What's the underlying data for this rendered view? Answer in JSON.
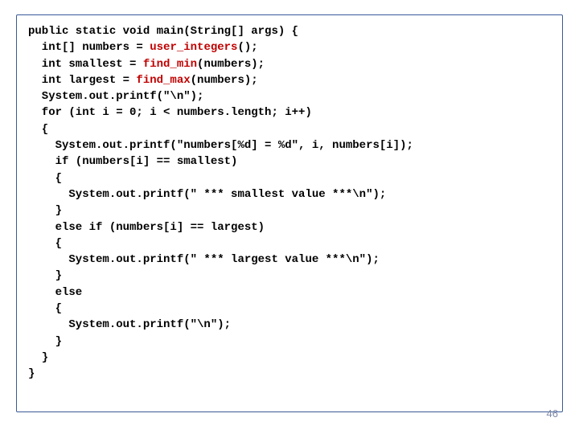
{
  "page_number": "46",
  "code": {
    "l0a": "public static void main(String[] args) {",
    "l1a": "  int[] numbers = ",
    "l1b": "user_integers",
    "l1c": "();",
    "l2a": "  int smallest = ",
    "l2b": "find_min",
    "l2c": "(numbers);",
    "l3a": "  int largest = ",
    "l3b": "find_max",
    "l3c": "(numbers);",
    "l4a": "  System.out.printf(\"\\n\");",
    "l5a": "  for (int i = 0; i < numbers.length; i++)",
    "l6a": "  {",
    "l7a": "    System.out.printf(\"numbers[%d] = %d\", i, numbers[i]);",
    "l8a": "    if (numbers[i] == smallest)",
    "l9a": "    {",
    "l10a": "      System.out.printf(\" *** smallest value ***\\n\");",
    "l11a": "    }",
    "l12a": "    else if (numbers[i] == largest)",
    "l13a": "    {",
    "l14a": "      System.out.printf(\" *** largest value ***\\n\");",
    "l15a": "    }",
    "l16a": "    else",
    "l17a": "    {",
    "l18a": "      System.out.printf(\"\\n\");",
    "l19a": "    }",
    "l20a": "  }",
    "l21a": "}"
  }
}
